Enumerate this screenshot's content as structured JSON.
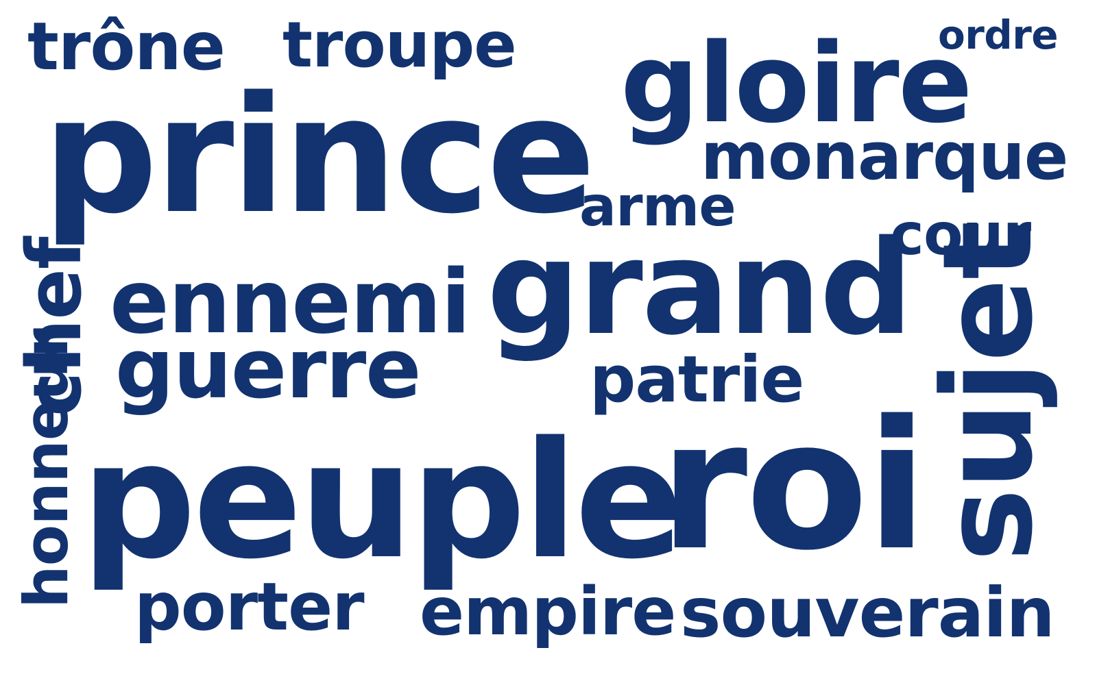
{
  "word_cloud": {
    "text_color": "#12336f",
    "background": "#ffffff",
    "words": {
      "trone": "trône",
      "troupe": "troupe",
      "ordre": "ordre",
      "prince": "prince",
      "gloire": "gloire",
      "monarque": "monarque",
      "arme": "arme",
      "cour": "cour",
      "ennemi": "ennemi",
      "grand": "grand",
      "guerre": "guerre",
      "patrie": "patrie",
      "chef": "chef",
      "honneur": "honneur",
      "peuple": "peuple",
      "roi": "roi",
      "sujet": "sujet",
      "porter": "porter",
      "empire": "empire",
      "souverain": "souverain"
    }
  }
}
